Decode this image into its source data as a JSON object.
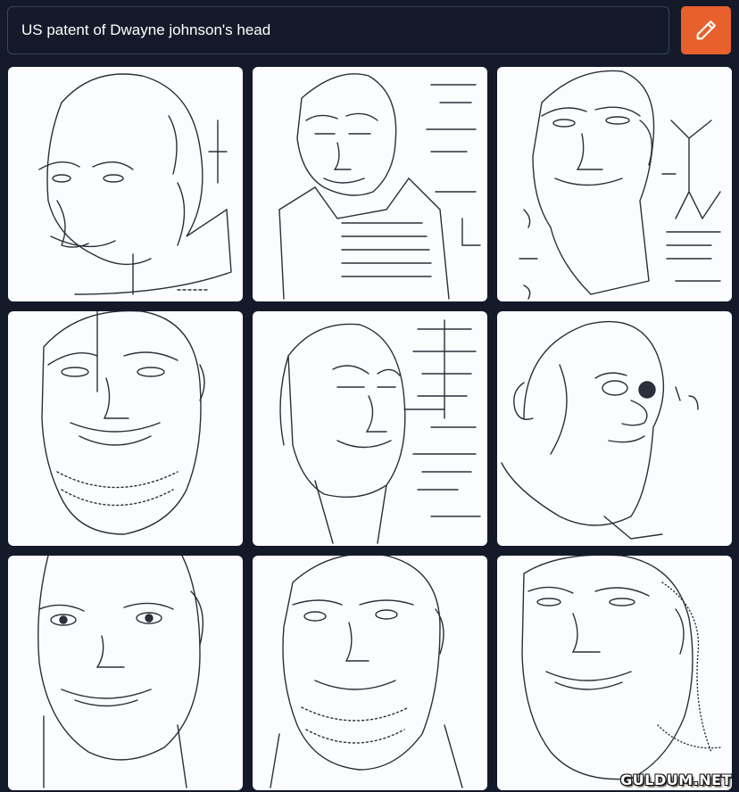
{
  "prompt": {
    "value": "US patent of Dwayne johnson's head"
  },
  "generate_button": {
    "icon": "pencil-icon",
    "color": "#e8602d"
  },
  "results": [
    {
      "style": "left-profile-sketch"
    },
    {
      "style": "front-collar-sketch"
    },
    {
      "style": "right-turn-diagram"
    },
    {
      "style": "front-shaded-sketch"
    },
    {
      "style": "side-tilt-diagram"
    },
    {
      "style": "three-quarter-sketch"
    },
    {
      "style": "front-close-sketch"
    },
    {
      "style": "front-stippled-sketch"
    },
    {
      "style": "right-close-sketch"
    }
  ],
  "watermark": "GULDUM.NET",
  "colors": {
    "background": "#141a2a",
    "tile": "#fbfcfd",
    "accent": "#e8602d"
  }
}
